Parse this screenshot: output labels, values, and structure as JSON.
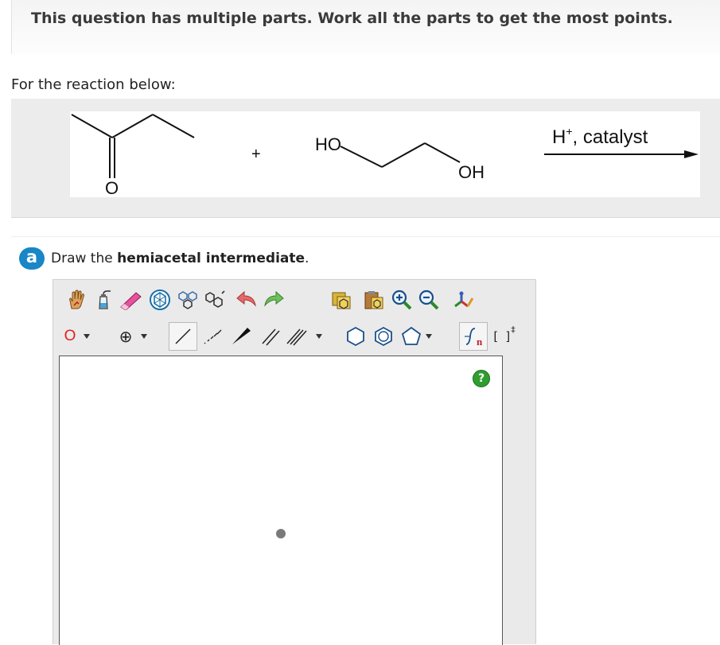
{
  "banner": {
    "text": "This question has multiple parts. Work all the parts to get the most points."
  },
  "intro": {
    "text": "For the reaction below:"
  },
  "reaction": {
    "plus": "+",
    "ketone_oxygen": "O",
    "diol_left_label": "HO",
    "diol_right_label": "OH",
    "conditions_base": "H",
    "conditions_superscript": "+",
    "conditions_rest": ", catalyst"
  },
  "part_a": {
    "badge": "a",
    "prompt_prefix": "Draw the ",
    "prompt_bold": "hemiacetal intermediate",
    "prompt_suffix": "."
  },
  "editor": {
    "toolbar_row1": [
      "hand-tool",
      "erlenmeyer-flask-tool",
      "eraser-tool",
      "template-tool",
      "ring-templates-tool",
      "chain-templates-tool",
      "undo-tool",
      "redo-tool",
      "copy-tool",
      "paste-tool",
      "zoom-in-tool",
      "zoom-out-tool",
      "clean-structure-tool"
    ],
    "atom_button": "O",
    "charge_button": "⊕",
    "sgroup_label": "n",
    "brackets_label": "[ ]",
    "brackets_sup": "‡",
    "help_label": "?",
    "accent_color": "#1886c7"
  }
}
